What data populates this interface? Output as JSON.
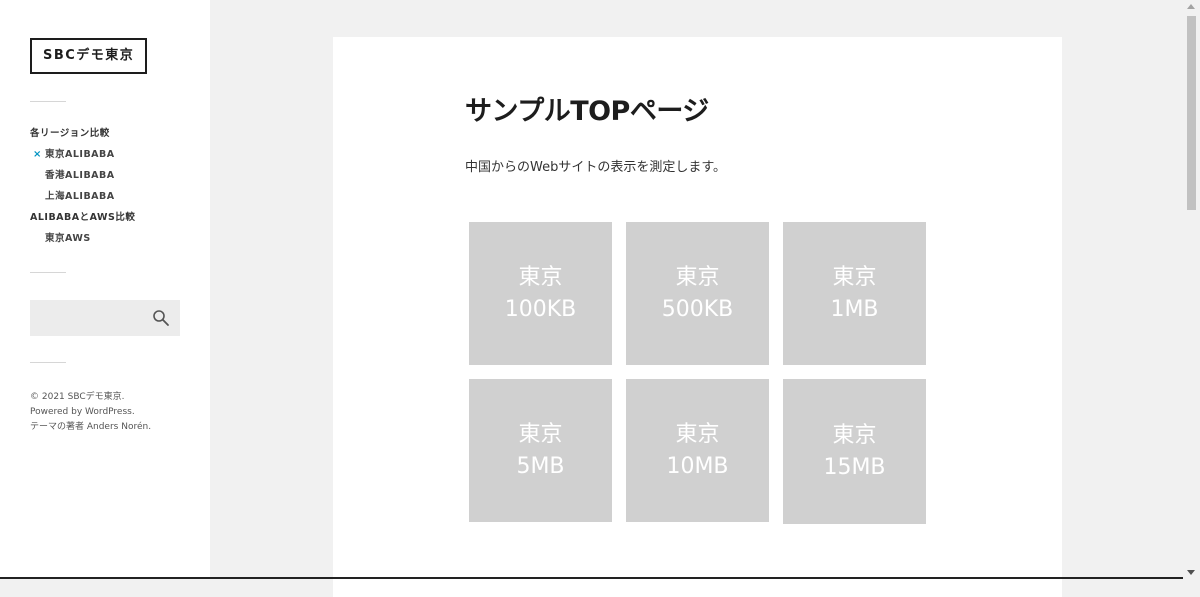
{
  "site": {
    "title": "SBCデモ東京"
  },
  "menu": {
    "items": [
      {
        "label": "各リージョン比較",
        "level": 0,
        "current": false
      },
      {
        "label": "東京ALIBABA",
        "level": 1,
        "current": true
      },
      {
        "label": "香港ALIBABA",
        "level": 1,
        "current": false
      },
      {
        "label": "上海ALIBABA",
        "level": 1,
        "current": false
      },
      {
        "label": "ALIBABAとAWS比較",
        "level": 0,
        "current": false
      },
      {
        "label": "東京AWS",
        "level": 1,
        "current": false
      }
    ],
    "current_marker": "×"
  },
  "search": {
    "placeholder": "",
    "value": ""
  },
  "footer": {
    "copyright": "© 2021 SBCデモ東京.",
    "powered": "Powered by WordPress.",
    "theme": "テーマの著者 Anders Norén."
  },
  "page": {
    "title": "サンプルTOPページ",
    "intro": "中国からのWebサイトの表示を測定します。",
    "tiles": [
      {
        "city": "東京",
        "size": "100KB"
      },
      {
        "city": "東京",
        "size": "500KB"
      },
      {
        "city": "東京",
        "size": "1MB"
      },
      {
        "city": "東京",
        "size": "5MB"
      },
      {
        "city": "東京",
        "size": "10MB"
      },
      {
        "city": "東京",
        "size": "15MB"
      }
    ]
  },
  "colors": {
    "accent": "#0093c2",
    "tile": "#d0d0d0",
    "background": "#f1f1f1"
  }
}
